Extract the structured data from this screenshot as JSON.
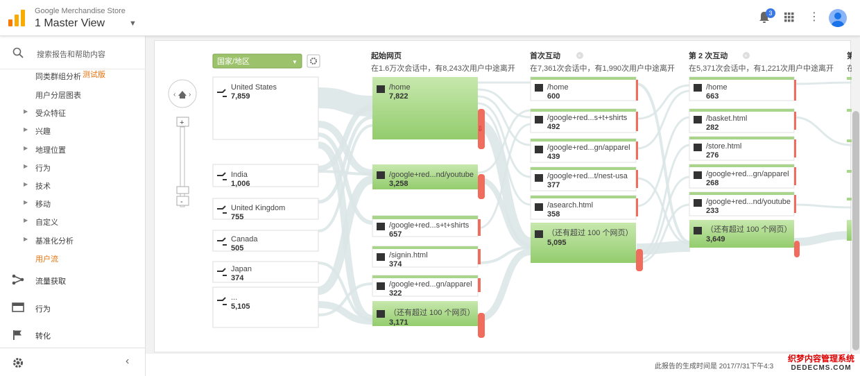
{
  "topbar": {
    "account": "Google Merchandise Store",
    "view": "1 Master View",
    "notification_count": "3"
  },
  "sidebar": {
    "search_label": "搜索报告和帮助内容",
    "items": [
      {
        "label": "同类群组分析",
        "badge": "测试版"
      },
      {
        "label": "用户分层图表"
      },
      {
        "label": "受众特征"
      },
      {
        "label": "兴趣"
      },
      {
        "label": "地理位置"
      },
      {
        "label": "行为"
      },
      {
        "label": "技术"
      },
      {
        "label": "移动"
      },
      {
        "label": "自定义"
      },
      {
        "label": "基准化分析"
      },
      {
        "label": "用户流"
      }
    ],
    "sections": [
      {
        "label": "流量获取",
        "icon": "acquisition-icon"
      },
      {
        "label": "行为",
        "icon": "behavior-icon"
      },
      {
        "label": "转化",
        "icon": "flag-icon"
      }
    ]
  },
  "flow": {
    "dimension": "国家/地区",
    "columns": [
      {
        "title": "起始网页",
        "subtitle": "在1.6万次会话中，有8,243次用户中途离开"
      },
      {
        "title": "首次互动",
        "subtitle": "在7,361次会话中，有1,990次用户中途离开"
      },
      {
        "title": "第 2 次互动",
        "subtitle": "在5,371次会话中，有1,221次用户中途离开"
      },
      {
        "title": "第",
        "subtitle": "在"
      }
    ],
    "countries": [
      {
        "name": "United States",
        "value": "7,859"
      },
      {
        "name": "India",
        "value": "1,006"
      },
      {
        "name": "United Kingdom",
        "value": "755"
      },
      {
        "name": "Canada",
        "value": "505"
      },
      {
        "name": "Japan",
        "value": "374"
      },
      {
        "name": "...",
        "value": "5,105"
      }
    ],
    "start_pages": [
      {
        "name": "/home",
        "value": "7,822"
      },
      {
        "name": "/google+red...nd/youtube",
        "value": "3,258"
      },
      {
        "name": "/google+red...s+t+shirts",
        "value": "657"
      },
      {
        "name": "/signin.html",
        "value": "374"
      },
      {
        "name": "/google+red...gn/apparel",
        "value": "322"
      },
      {
        "name": "（还有超过 100 个网页）",
        "value": "3,171"
      }
    ],
    "first_interaction": [
      {
        "name": "/home",
        "value": "600"
      },
      {
        "name": "/google+red...s+t+shirts",
        "value": "492"
      },
      {
        "name": "/google+red...gn/apparel",
        "value": "439"
      },
      {
        "name": "/google+red...t/nest-usa",
        "value": "377"
      },
      {
        "name": "/asearch.html",
        "value": "358"
      },
      {
        "name": "（还有超过 100 个网页）",
        "value": "5,095"
      }
    ],
    "second_interaction": [
      {
        "name": "/home",
        "value": "663"
      },
      {
        "name": "/basket.html",
        "value": "282"
      },
      {
        "name": "/store.html",
        "value": "276"
      },
      {
        "name": "/google+red...gn/apparel",
        "value": "268"
      },
      {
        "name": "/google+red...nd/youtube",
        "value": "233"
      },
      {
        "name": "（还有超过 100 个网页）",
        "value": "3,649"
      }
    ]
  },
  "footer": {
    "generated": "此报告的生成时间是 2017/7/31下午4:3"
  },
  "watermark": {
    "line1": "织梦内容管理系统",
    "line2": "DEDECMS.COM"
  },
  "colors": {
    "accent_orange": "#e8710a",
    "node_green": "#a8d58a",
    "dropoff_red": "#f06c5c",
    "link_gray": "#d9e3e3"
  }
}
